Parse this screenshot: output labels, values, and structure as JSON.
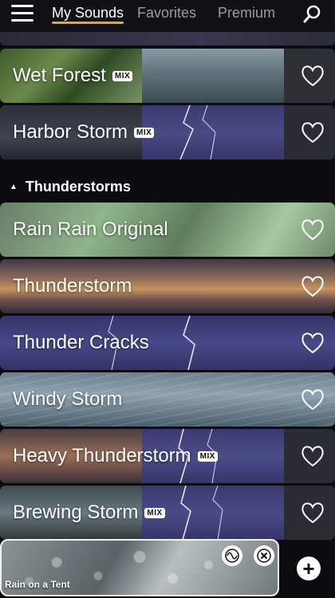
{
  "nav": {
    "tabs": [
      {
        "label": "My Sounds",
        "active": true
      },
      {
        "label": "Favorites",
        "active": false
      },
      {
        "label": "Premium",
        "active": false
      }
    ],
    "icons": [
      "menu-icon",
      "search-icon"
    ],
    "accent_color": "#e2a81e"
  },
  "sounds_top": [
    {
      "label": "Wet Forest",
      "mix": "MIX",
      "favorite": false
    },
    {
      "label": "Harbor Storm",
      "mix": "MIX",
      "favorite": false
    }
  ],
  "section": {
    "title": "Thunderstorms",
    "expanded": true
  },
  "sounds": [
    {
      "label": "Rain Rain Original",
      "mix": "",
      "favorite": false
    },
    {
      "label": "Thunderstorm",
      "mix": "",
      "favorite": false
    },
    {
      "label": "Thunder Cracks",
      "mix": "",
      "favorite": false
    },
    {
      "label": "Windy Storm",
      "mix": "",
      "favorite": false
    },
    {
      "label": "Heavy Thunderstorm",
      "mix": "MIX",
      "favorite": false
    },
    {
      "label": "Brewing Storm",
      "mix": "MIX",
      "favorite": false
    }
  ],
  "player": {
    "now_playing": "Rain on a Tent",
    "icons": [
      "wave-icon",
      "close-icon",
      "add-icon"
    ]
  }
}
